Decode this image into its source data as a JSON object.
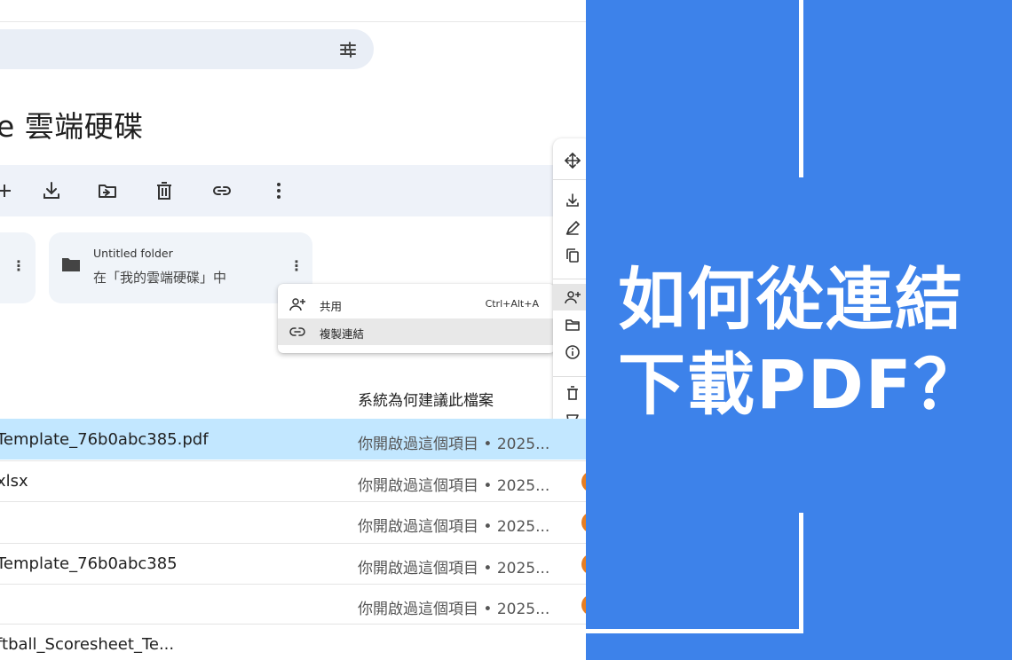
{
  "drive": {
    "title": "e 雲端硬碟",
    "folder": {
      "name": "Untitled folder",
      "location": "在「我的雲端硬碟」中"
    },
    "context_menu": [
      {
        "label": "共用",
        "shortcut": "Ctrl+Alt+A"
      },
      {
        "label": "複製連結",
        "shortcut": ""
      }
    ],
    "list": {
      "column_header": "系統為何建議此檔案",
      "rows": [
        {
          "name": "Template_76b0abc385.pdf",
          "reason": "你開啟過這個項目 • 2025...",
          "selected": true
        },
        {
          "name": "xlsx",
          "reason": "你開啟過這個項目 • 2025...",
          "selected": false
        },
        {
          "name": "",
          "reason": "你開啟過這個項目 • 2025...",
          "selected": false
        },
        {
          "name": "Template_76b0abc385",
          "reason": "你開啟過這個項目 • 2025...",
          "selected": false
        },
        {
          "name": "",
          "reason": "你開啟過這個項目 • 2025...",
          "selected": false
        },
        {
          "name": "ftball_Scoresheet_Te...",
          "reason": "",
          "selected": false
        }
      ]
    },
    "toolbar_icons": [
      "add-icon",
      "download-icon",
      "move-to-folder-icon",
      "trash-icon",
      "link-icon",
      "more-vert-icon"
    ],
    "rail_icons": [
      "move-icon",
      "download-icon",
      "rename-icon",
      "copy-icon",
      "share-icon",
      "folder-open-icon",
      "info-icon",
      "trash-icon",
      "report-icon"
    ],
    "avatar_color": "#e67e22",
    "selected_row_color": "#c2e7ff"
  },
  "banner": {
    "line1": "如何從連結",
    "line2": "下載PDF？",
    "background": "#3d82ea"
  }
}
